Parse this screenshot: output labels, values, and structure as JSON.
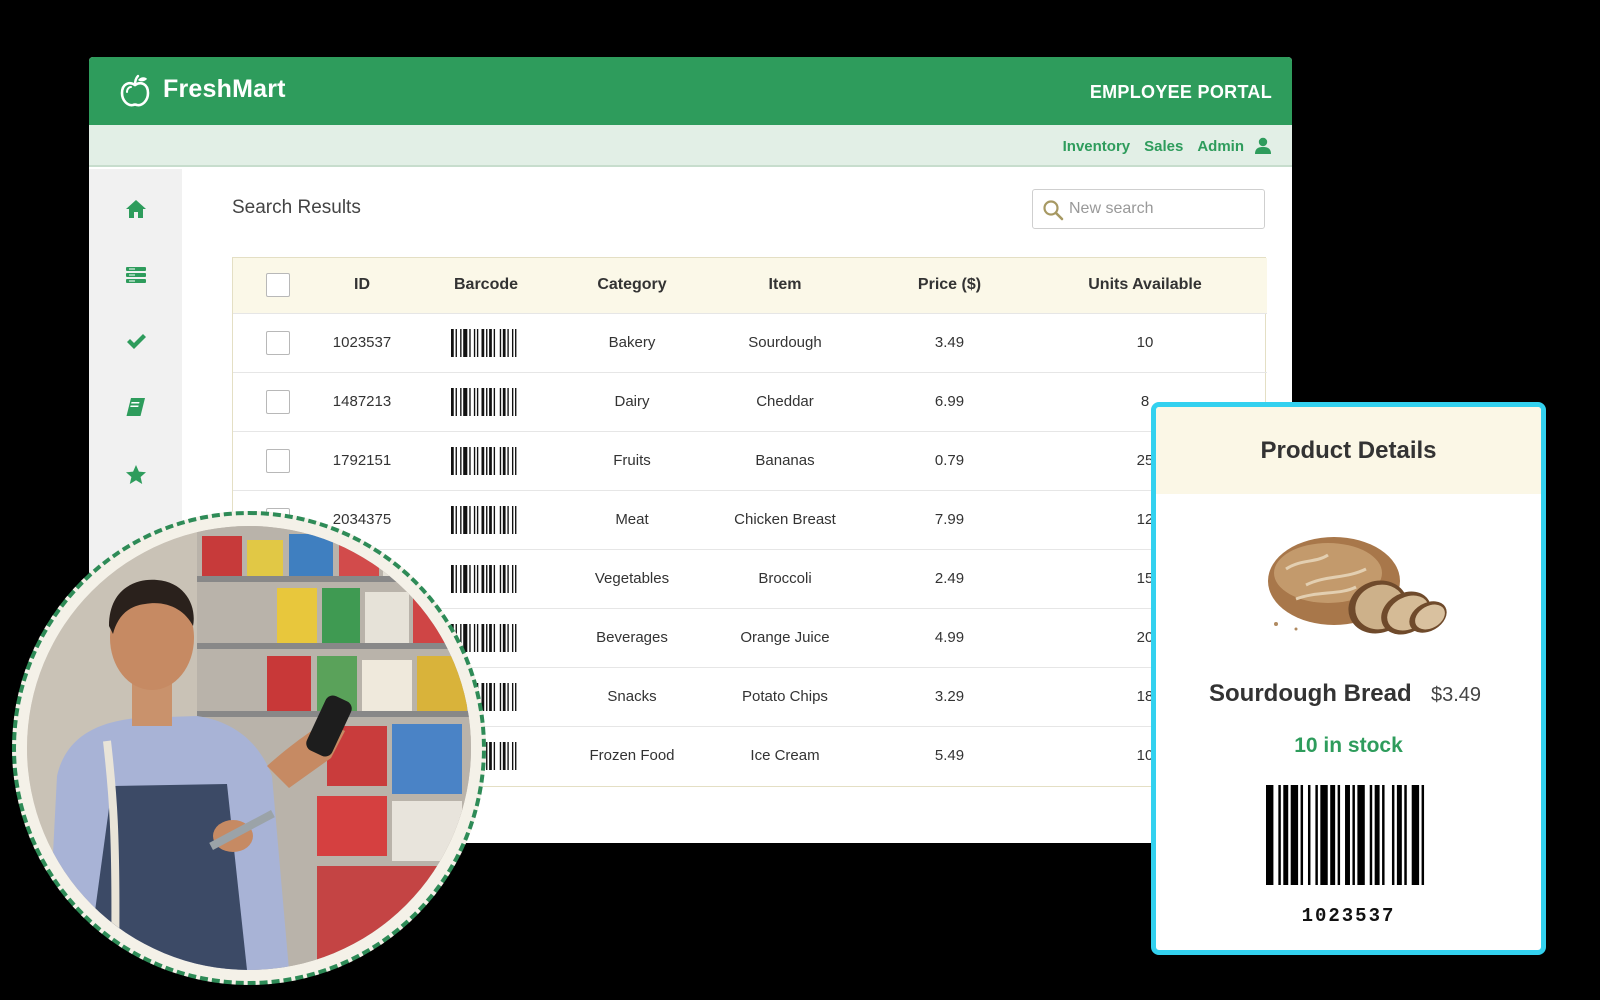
{
  "app": {
    "brand": "FreshMart",
    "portal_label": "EMPLOYEE PORTAL",
    "accent_color": "#2e9c5c"
  },
  "subnav": {
    "links": [
      "Inventory",
      "Sales",
      "Admin"
    ],
    "user_icon": "user-icon"
  },
  "sidebar": {
    "items": [
      {
        "icon": "home-icon"
      },
      {
        "icon": "list-icon"
      },
      {
        "icon": "check-icon"
      },
      {
        "icon": "book-icon"
      },
      {
        "icon": "star-icon"
      }
    ]
  },
  "main": {
    "title": "Search Results",
    "search": {
      "placeholder": "New search",
      "value": ""
    }
  },
  "table": {
    "columns": [
      "ID",
      "Barcode",
      "Category",
      "Item",
      "Price ($)",
      "Units Available"
    ],
    "rows": [
      {
        "id": "1023537",
        "category": "Bakery",
        "item": "Sourdough",
        "price": "3.49",
        "units": "10"
      },
      {
        "id": "1487213",
        "category": "Dairy",
        "item": "Cheddar",
        "price": "6.99",
        "units": "8"
      },
      {
        "id": "1792151",
        "category": "Fruits",
        "item": "Bananas",
        "price": "0.79",
        "units": "25"
      },
      {
        "id": "2034375",
        "category": "Meat",
        "item": "Chicken Breast",
        "price": "7.99",
        "units": "12"
      },
      {
        "id": "",
        "category": "Vegetables",
        "item": "Broccoli",
        "price": "2.49",
        "units": "15"
      },
      {
        "id": "",
        "category": "Beverages",
        "item": "Orange Juice",
        "price": "4.99",
        "units": "20"
      },
      {
        "id": "",
        "category": "Snacks",
        "item": "Potato Chips",
        "price": "3.29",
        "units": "18"
      },
      {
        "id": "",
        "category": "Frozen Food",
        "item": "Ice Cream",
        "price": "5.49",
        "units": "10"
      }
    ]
  },
  "product": {
    "header": "Product Details",
    "name": "Sourdough Bread",
    "price": "$3.49",
    "stock": "10 in stock",
    "barcode": "1023537",
    "stock_color": "#2e9c5c"
  }
}
